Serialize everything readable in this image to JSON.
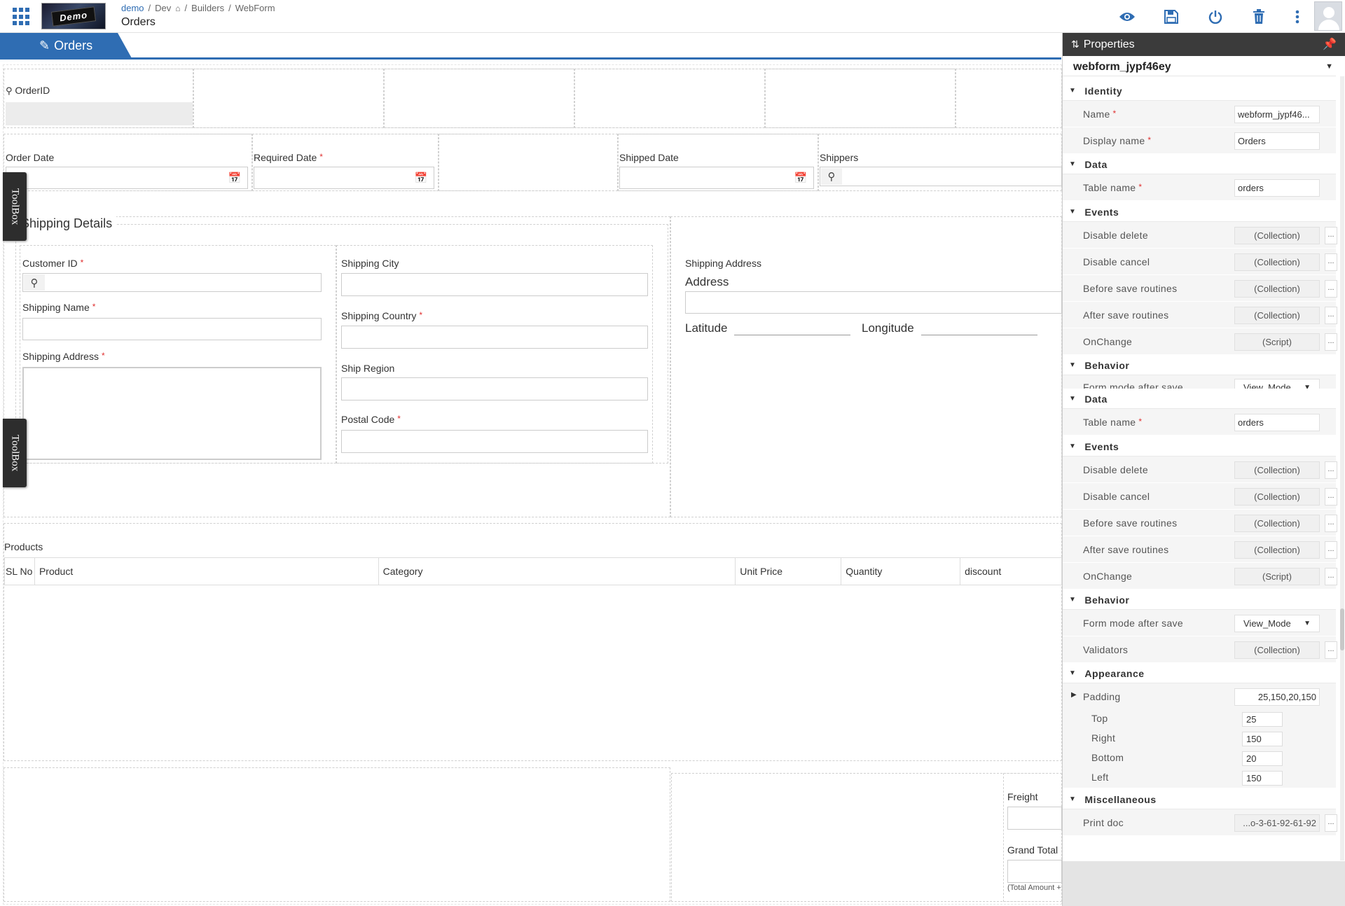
{
  "header": {
    "breadcrumb": {
      "root": "demo",
      "sep1": "/",
      "dev": "Dev",
      "sep2": "/",
      "builders": "Builders",
      "sep3": "/",
      "webform": "WebForm"
    },
    "title": "Orders",
    "logo_text": "Demo",
    "icons": [
      "view-icon",
      "save-icon",
      "power-icon",
      "delete-icon",
      "more-icon"
    ]
  },
  "tab": {
    "label": "Orders"
  },
  "form": {
    "order_id": {
      "label": "OrderID"
    },
    "order_date": {
      "label": "Order Date"
    },
    "required_date": {
      "label": "Required Date",
      "required": "*"
    },
    "shipped_date": {
      "label": "Shipped Date"
    },
    "shippers": {
      "label": "Shippers"
    },
    "shipping_details": {
      "title": "Shipping Details"
    },
    "customer_id": {
      "label": "Customer ID",
      "required": "*"
    },
    "shipping_name": {
      "label": "Shipping Name",
      "required": "*"
    },
    "shipping_address": {
      "label": "Shipping Address",
      "required": "*"
    },
    "shipping_city": {
      "label": "Shipping City"
    },
    "shipping_country": {
      "label": "Shipping Country",
      "required": "*"
    },
    "ship_region": {
      "label": "Ship Region"
    },
    "postal_code": {
      "label": "Postal Code",
      "required": "*"
    },
    "address_block": {
      "heading": "Shipping Address",
      "address": "Address",
      "latitude": "Latitude",
      "longitude": "Longitude"
    },
    "products": {
      "title": "Products",
      "columns": [
        "SL No",
        "Product",
        "Category",
        "Unit Price",
        "Quantity",
        "discount"
      ]
    },
    "freight": {
      "label": "Freight"
    },
    "grand_total": {
      "label": "Grand Total",
      "note": "(Total Amount + Freight)"
    },
    "toolbox_label": "ToolBox"
  },
  "properties": {
    "title": "Properties",
    "object": "webform_jypf46ey",
    "sections": {
      "identity": "Identity",
      "data": "Data",
      "events": "Events",
      "behavior": "Behavior",
      "appearance": "Appearance",
      "misc": "Miscellaneous"
    },
    "rows": {
      "name": {
        "label": "Name",
        "value": "webform_jypf46..."
      },
      "display_name": {
        "label": "Display name",
        "value": "Orders"
      },
      "table_name": {
        "label": "Table name",
        "value": "orders"
      },
      "disable_delete": {
        "label": "Disable delete",
        "value": "(Collection)"
      },
      "disable_cancel": {
        "label": "Disable cancel",
        "value": "(Collection)"
      },
      "before_save": {
        "label": "Before save routines",
        "value": "(Collection)"
      },
      "after_save": {
        "label": "After save routines",
        "value": "(Collection)"
      },
      "onchange": {
        "label": "OnChange",
        "value": "(Script)"
      },
      "form_mode": {
        "label": "Form mode after save",
        "value": "View_Mode"
      },
      "validators": {
        "label": "Validators",
        "value": "(Collection)"
      },
      "padding": {
        "label": "Padding",
        "value": "25,150,20,150"
      },
      "top": {
        "label": "Top",
        "value": "25"
      },
      "right": {
        "label": "Right",
        "value": "150"
      },
      "bottom": {
        "label": "Bottom",
        "value": "20"
      },
      "left": {
        "label": "Left",
        "value": "150"
      },
      "print_doc": {
        "label": "Print doc",
        "value": "...o-3-61-92-61-92"
      }
    },
    "dots": "..."
  }
}
